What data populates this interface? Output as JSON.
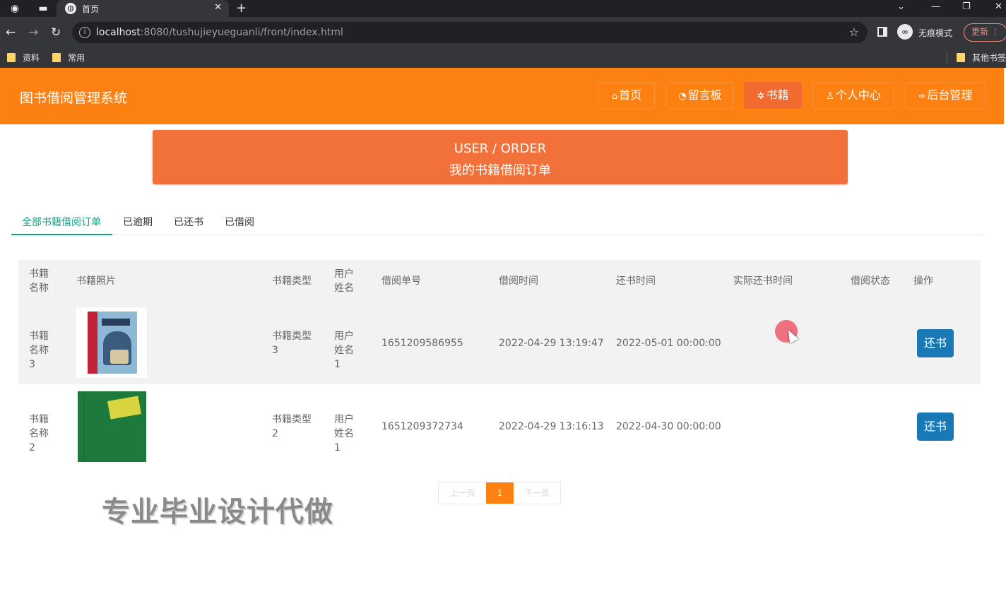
{
  "browser": {
    "tab_title": "首页",
    "url_host": "localhost",
    "url_rest": ":8080/tushujieyueguanli/front/index.html",
    "incognito_label": "无痕模式",
    "update_label": "更新",
    "bookmarks": [
      "资料",
      "常用"
    ],
    "other_bookmarks": "其他书签"
  },
  "site": {
    "title": "图书借阅管理系统",
    "nav": [
      {
        "label": "首页",
        "icon": "home-icon"
      },
      {
        "label": "留言板",
        "icon": "message-icon"
      },
      {
        "label": "书籍",
        "icon": "book-icon"
      },
      {
        "label": "个人中心",
        "icon": "user-icon"
      },
      {
        "label": "后台管理",
        "icon": "link-icon"
      }
    ],
    "active_nav": "书籍"
  },
  "banner": {
    "en": "USER / ORDER",
    "cn": "我的书籍借阅订单"
  },
  "tabs": [
    "全部书籍借阅订单",
    "已逾期",
    "已还书",
    "已借阅"
  ],
  "active_tab": "全部书籍借阅订单",
  "table": {
    "headers": [
      "书籍名称",
      "书籍照片",
      "书籍类型",
      "用户姓名",
      "借阅单号",
      "借阅时间",
      "还书时间",
      "实际还书时间",
      "借阅状态",
      "操作"
    ],
    "rows": [
      {
        "name": "书籍名称3",
        "type": "书籍类型3",
        "user": "用户姓名1",
        "order_no": "1651209586955",
        "borrow_time": "2022-04-29 13:19:47",
        "return_time": "2022-05-01 00:00:00",
        "actual_return_time": "",
        "status": "",
        "action": "还书"
      },
      {
        "name": "书籍名称2",
        "type": "书籍类型2",
        "user": "用户姓名1",
        "order_no": "1651209372734",
        "borrow_time": "2022-04-29 13:16:13",
        "return_time": "2022-04-30 00:00:00",
        "actual_return_time": "",
        "status": "",
        "action": "还书"
      }
    ]
  },
  "pagination": {
    "prev": "上一页",
    "current": "1",
    "next": "下一页"
  },
  "watermark": "专业毕业设计代做",
  "colors": {
    "header": "#fd8112",
    "banner": "#f2713b",
    "active_tab": "#14a085",
    "button": "#1979b7"
  }
}
